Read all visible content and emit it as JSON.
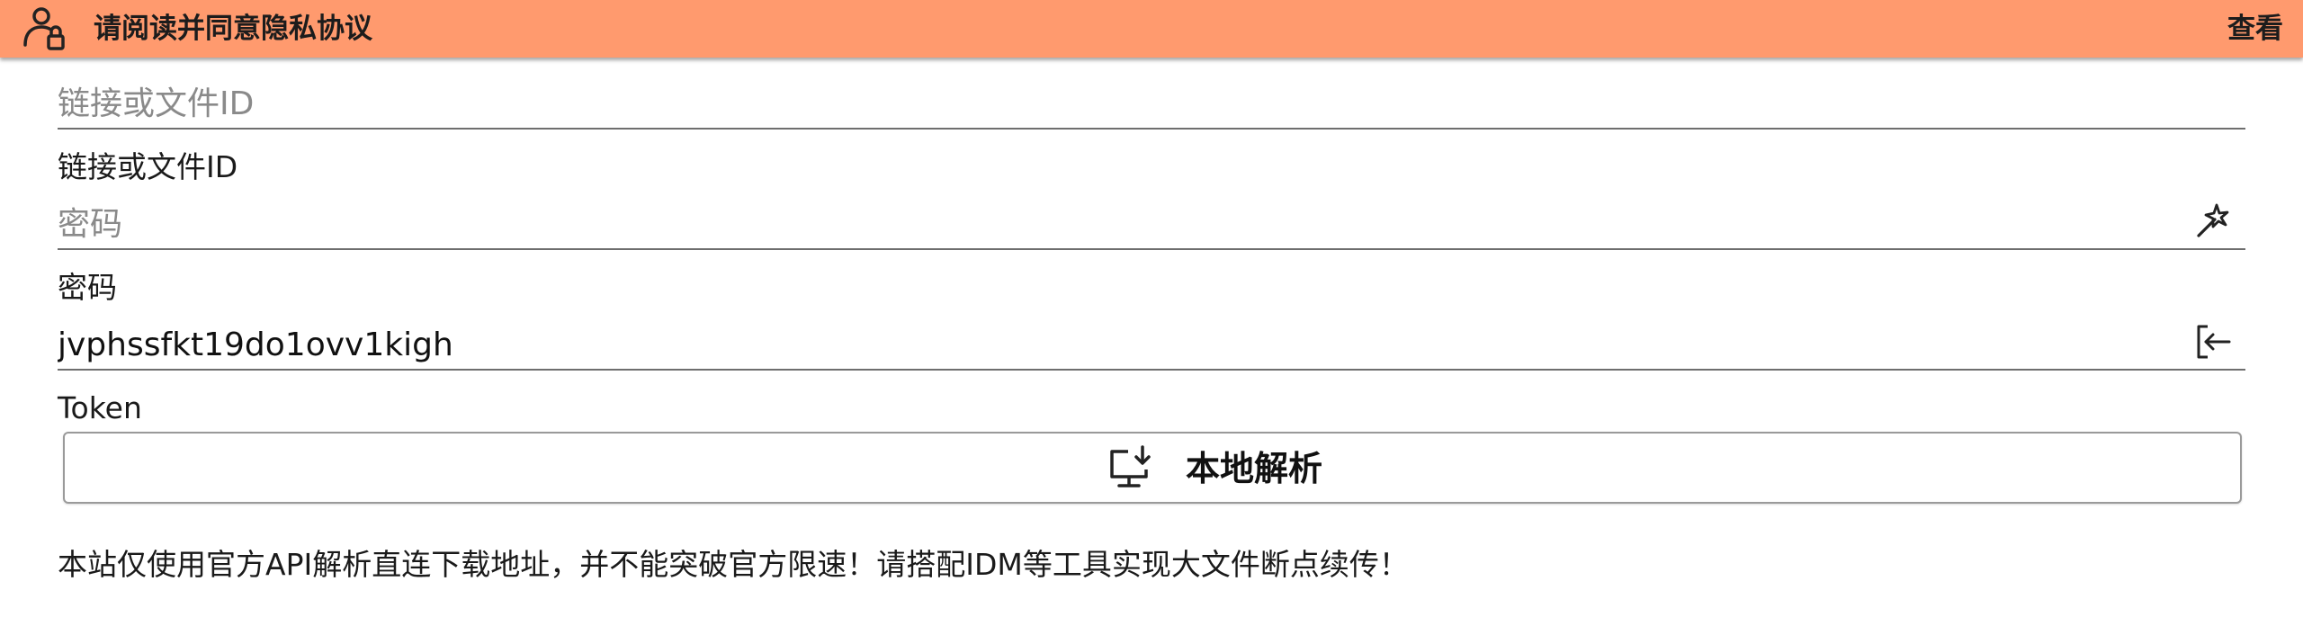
{
  "banner": {
    "title": "请阅读并同意隐私协议",
    "action_label": "查看",
    "background_color": "#ff9a6e",
    "icon": "user-lock-icon"
  },
  "form": {
    "link_field": {
      "placeholder": "链接或文件ID",
      "value": "",
      "helper": "链接或文件ID"
    },
    "password_field": {
      "placeholder": "密码",
      "value": "",
      "helper": "密码",
      "trailing_icon": "magic-wand-icon"
    },
    "token_field": {
      "value": "jvphssfkt19do1ovv1kigh",
      "helper": "Token",
      "trailing_icon": "login-icon"
    },
    "parse_button": {
      "label": "本地解析",
      "icon": "monitor-download-icon"
    }
  },
  "notice": "本站仅使用官方API解析直连下载地址，并不能突破官方限速！请搭配IDM等工具实现大文件断点续传！"
}
